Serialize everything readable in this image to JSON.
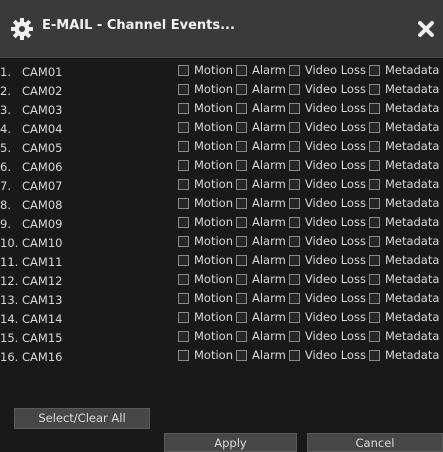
{
  "dialog": {
    "title": "E-MAIL - Channel Events...",
    "title_icon": "gear-icon",
    "close_icon": "close-icon"
  },
  "options": [
    "Motion",
    "Alarm",
    "Video Loss",
    "Metadata"
  ],
  "cameras": [
    {
      "num": "1.",
      "name": "CAM01"
    },
    {
      "num": "2.",
      "name": "CAM02"
    },
    {
      "num": "3.",
      "name": "CAM03"
    },
    {
      "num": "4.",
      "name": "CAM04"
    },
    {
      "num": "5.",
      "name": "CAM05"
    },
    {
      "num": "6.",
      "name": "CAM06"
    },
    {
      "num": "7.",
      "name": "CAM07"
    },
    {
      "num": "8.",
      "name": "CAM08"
    },
    {
      "num": "9.",
      "name": "CAM09"
    },
    {
      "num": "10.",
      "name": "CAM10"
    },
    {
      "num": "11.",
      "name": "CAM11"
    },
    {
      "num": "12.",
      "name": "CAM12"
    },
    {
      "num": "13.",
      "name": "CAM13"
    },
    {
      "num": "14.",
      "name": "CAM14"
    },
    {
      "num": "15.",
      "name": "CAM15"
    },
    {
      "num": "16.",
      "name": "CAM16"
    }
  ],
  "buttons": {
    "select_clear_all": "Select/Clear All",
    "apply": "Apply",
    "cancel": "Cancel"
  },
  "colors": {
    "title_bar": "#3a3a3a",
    "background": "#191919",
    "button": "#474747"
  }
}
